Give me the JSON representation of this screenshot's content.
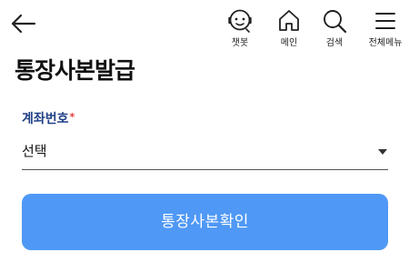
{
  "header": {
    "back_icon": "arrow-left-icon",
    "nav": [
      {
        "id": "chatbot",
        "label": "챗봇",
        "icon": "chatbot-icon"
      },
      {
        "id": "main",
        "label": "메인",
        "icon": "home-icon"
      },
      {
        "id": "search",
        "label": "검색",
        "icon": "search-icon"
      },
      {
        "id": "menu",
        "label": "전체메뉴",
        "icon": "hamburger-menu-icon"
      }
    ]
  },
  "page": {
    "title": "통장사본발급"
  },
  "form": {
    "account_label": "계좌번호",
    "required_mark": "*",
    "account_select_value": "선택"
  },
  "actions": {
    "confirm_label": "통장사본확인"
  },
  "colors": {
    "label": "#1f3f86",
    "required": "#e53935",
    "primary_button": "#4f98f5",
    "primary_button_text": "#ffffff"
  }
}
